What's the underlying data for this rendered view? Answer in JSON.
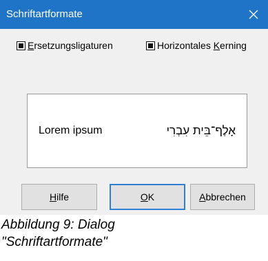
{
  "dialog": {
    "title": "Schriftartformate",
    "close_icon": "close-icon"
  },
  "options": {
    "ligatures": {
      "label_accel": "E",
      "label_rest": "rsetzungsligaturen",
      "checked": true
    },
    "kerning": {
      "label_before": "Horizontales ",
      "label_accel": "K",
      "label_rest": "erning",
      "checked": true
    }
  },
  "preview": {
    "latin_text": "Lorem ipsum",
    "hebrew_text": "אָלֶף־בֵּית עִבְרִי"
  },
  "buttons": {
    "help": {
      "accel": "H",
      "rest": "ilfe"
    },
    "ok": {
      "accel": "O",
      "rest": "K"
    },
    "cancel": {
      "accel": "A",
      "rest": "bbrechen"
    }
  },
  "caption": {
    "line1": "Abbildung 9: Dialog",
    "line2": "\"Schriftartformate\""
  }
}
